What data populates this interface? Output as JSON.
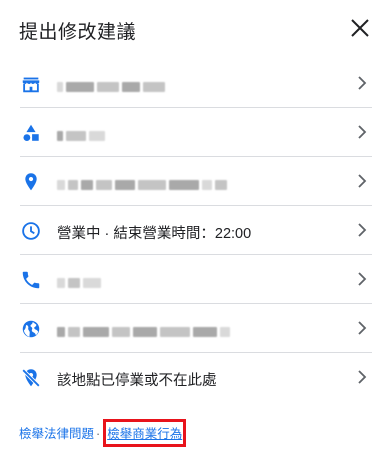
{
  "dialog": {
    "title": "提出修改建議"
  },
  "rows": [
    {
      "kind": "redacted",
      "icon": "store-icon"
    },
    {
      "kind": "redacted",
      "icon": "category-shapes-icon"
    },
    {
      "kind": "redacted",
      "icon": "location-pin-icon"
    },
    {
      "kind": "text",
      "icon": "clock-icon",
      "label": "營業中 · 結束營業時間：22:00"
    },
    {
      "kind": "redacted",
      "icon": "phone-icon"
    },
    {
      "kind": "redacted",
      "icon": "globe-icon"
    },
    {
      "kind": "text",
      "icon": "closed-location-icon",
      "label": "該地點已停業或不在此處"
    }
  ],
  "footer": {
    "report_legal": "檢舉法律問題",
    "separator": "·",
    "report_business": "檢舉商業行為"
  },
  "colors": {
    "icon_blue": "#1a73e8",
    "text": "#202124",
    "divider": "#dadce0",
    "highlight_red": "#e8131b"
  }
}
